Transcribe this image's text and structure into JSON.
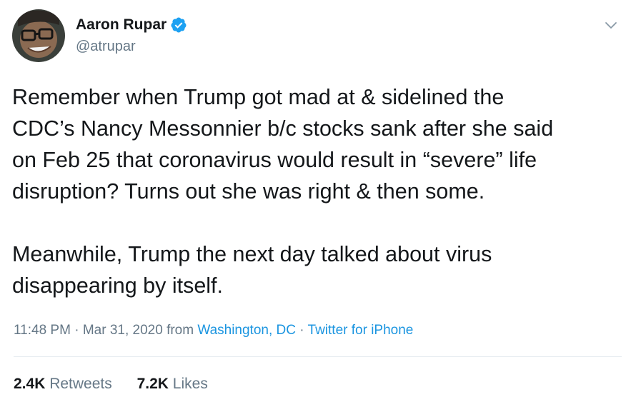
{
  "author": {
    "display_name": "Aaron Rupar",
    "handle": "@atrupar",
    "verified": true,
    "verified_icon": "verified-badge-icon",
    "avatar": "profile-photo"
  },
  "menu_icon": "chevron-down-icon",
  "tweet": {
    "text": "Remember when Trump got mad at & sidelined the\nCDC’s Nancy Messonnier b/c stocks sank after she said\non Feb 25 that coronavirus would result in “severe” life\ndisruption? Turns out she was right & then some.\n\nMeanwhile, Trump the next day talked about virus\ndisappearing by itself."
  },
  "meta": {
    "time": "11:48 PM",
    "separator": "·",
    "date": "Mar 31, 2020",
    "from_label": "from",
    "location": "Washington, DC",
    "source": "Twitter for iPhone"
  },
  "stats": {
    "retweets_count": "2.4K",
    "retweets_label": "Retweets",
    "likes_count": "7.2K",
    "likes_label": "Likes"
  },
  "colors": {
    "text": "#14171a",
    "secondary": "#657786",
    "link": "#1b95e0",
    "verified": "#1da1f2",
    "divider": "#e6ecf0"
  }
}
